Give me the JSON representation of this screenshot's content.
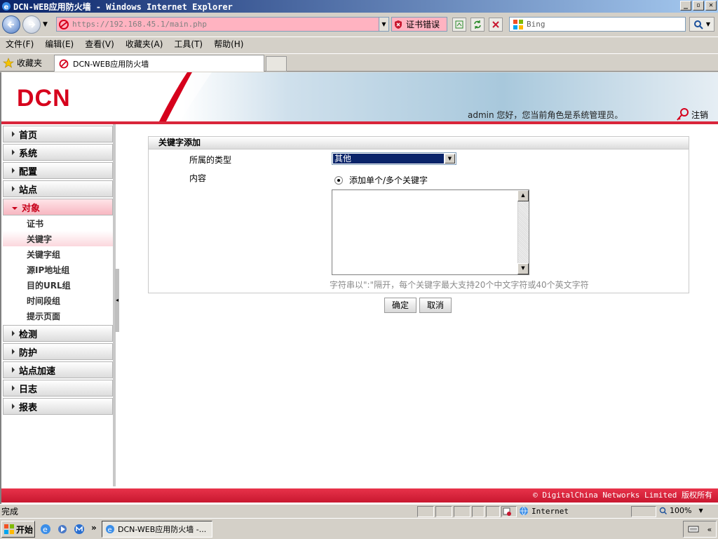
{
  "window": {
    "title": "DCN-WEB应用防火墙 - Windows Internet Explorer",
    "minimize": "_",
    "maximize": "▫",
    "close": "✕"
  },
  "addressbar": {
    "url": "https://192.168.45.1/main.php",
    "cert_error": "证书错误",
    "search_placeholder": "Bing"
  },
  "menu": [
    "文件(F)",
    "编辑(E)",
    "查看(V)",
    "收藏夹(A)",
    "工具(T)",
    "帮助(H)"
  ],
  "favorites": {
    "label": "收藏夹",
    "tab_title": "DCN-WEB应用防火墙"
  },
  "header": {
    "logo": "DCN",
    "welcome": "admin 您好，您当前角色是系统管理员。",
    "logout": "注销"
  },
  "sidebar": {
    "top_items": [
      "首页",
      "系统",
      "配置",
      "站点"
    ],
    "open_item": "对象",
    "sub_items": [
      "证书",
      "关键字",
      "关键字组",
      "源IP地址组",
      "目的URL组",
      "时间段组",
      "提示页面"
    ],
    "active_sub": "关键字",
    "bottom_items": [
      "检测",
      "防护",
      "站点加速",
      "日志",
      "报表"
    ]
  },
  "form": {
    "title": "关键字添加",
    "type_label": "所属的类型",
    "type_value": "其他",
    "content_label": "内容",
    "radio_label": "添加单个/多个关键字",
    "hint": "字符串以\":\"隔开，每个关键字最大支持20个中文字符或40个英文字符",
    "ok": "确定",
    "cancel": "取消"
  },
  "footer": {
    "copyright": "© DigitalChina Networks Limited 版权所有"
  },
  "statusbar": {
    "status": "完成",
    "zone": "Internet",
    "zoom": "100%"
  },
  "taskbar": {
    "start": "开始",
    "task": "DCN-WEB应用防火墙 -..."
  },
  "colors": {
    "brand_red": "#d6001c",
    "footer_red": "#d9263b",
    "selection_blue": "#0a246a"
  }
}
